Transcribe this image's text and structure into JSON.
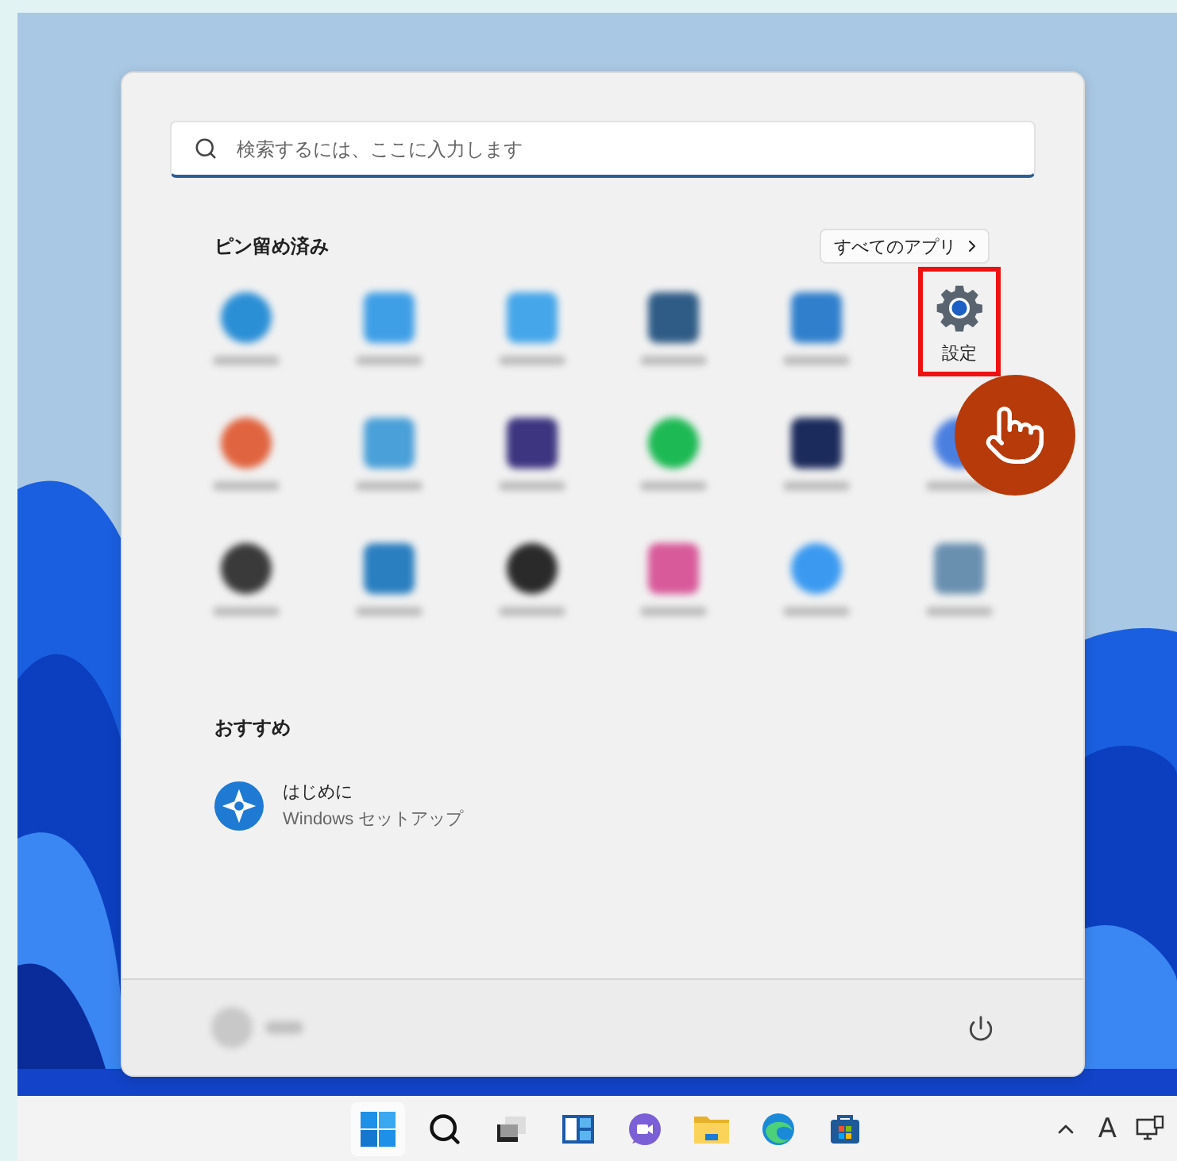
{
  "start_menu": {
    "search": {
      "placeholder": "検索するには、ここに入力します"
    },
    "pinned": {
      "heading": "ピン留め済み",
      "all_apps_button": "すべてのアプリ",
      "apps": [
        {
          "kind": "round",
          "color": "#2b8fd6"
        },
        {
          "kind": "square",
          "color": "#3f9fe6"
        },
        {
          "kind": "square",
          "color": "#45a6ea"
        },
        {
          "kind": "square",
          "color": "#2f5c86"
        },
        {
          "kind": "square",
          "color": "#2f7fcc"
        },
        {
          "kind": "settings",
          "label": "設定",
          "highlighted": true
        },
        {
          "kind": "round",
          "color": "#e0643f"
        },
        {
          "kind": "square",
          "color": "#4aa0d8"
        },
        {
          "kind": "square",
          "color": "#3d3580"
        },
        {
          "kind": "round",
          "color": "#1db954"
        },
        {
          "kind": "square",
          "color": "#1b2b5c"
        },
        {
          "kind": "round",
          "color": "#4a7fe0"
        },
        {
          "kind": "round",
          "color": "#3a3a3a"
        },
        {
          "kind": "square",
          "color": "#2a7fc0"
        },
        {
          "kind": "round",
          "color": "#2a2a2a"
        },
        {
          "kind": "square",
          "color": "#d85a9a"
        },
        {
          "kind": "round",
          "color": "#3b9af0"
        },
        {
          "kind": "square",
          "color": "#6a90b0"
        }
      ]
    },
    "recommended": {
      "heading": "おすすめ",
      "items": [
        {
          "title": "はじめに",
          "subtitle": "Windows セットアップ"
        }
      ]
    }
  },
  "taskbar": {
    "input_indicator": "A"
  }
}
